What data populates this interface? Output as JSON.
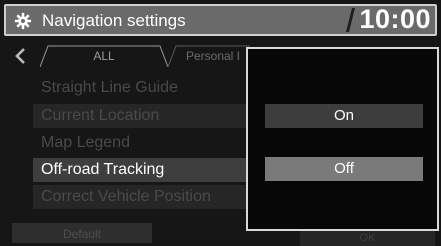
{
  "header": {
    "title": "Navigation settings",
    "clock": "10:00",
    "icon": "gear-icon"
  },
  "tabs": [
    {
      "label": "ALL"
    },
    {
      "label": "Personal I"
    }
  ],
  "settings": [
    {
      "label": "Straight Line Guide"
    },
    {
      "label": "Current Location"
    },
    {
      "label": "Map Legend"
    },
    {
      "label": "Off-road Tracking"
    },
    {
      "label": "Correct Vehicle Position"
    }
  ],
  "buttons": {
    "default_label": "Default",
    "right_label": "OK"
  },
  "popup": {
    "options": [
      {
        "label": "On",
        "selected": false
      },
      {
        "label": "Off",
        "selected": true
      }
    ]
  },
  "colors": {
    "header_bg": "#6a6a6a",
    "selected_option": "#7a7a7a",
    "unselected_option": "#3d3d3d"
  }
}
